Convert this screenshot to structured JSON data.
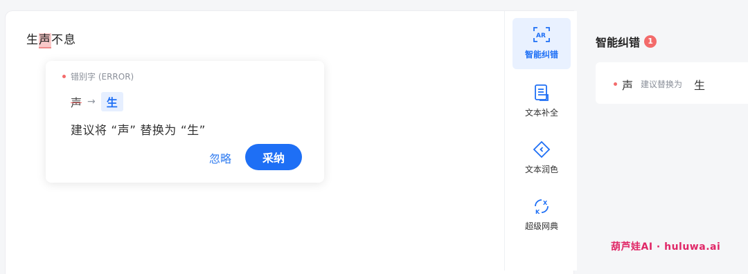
{
  "editor": {
    "before": "生",
    "error_char": "声",
    "after": "不息"
  },
  "popup": {
    "type_label": "错别字 (ERROR)",
    "original": "声",
    "arrow": "→",
    "replacement": "生",
    "description": "建议将 “声” 替换为 “生”",
    "ignore_label": "忽略",
    "adopt_label": "采纳"
  },
  "toolbar": {
    "items": [
      {
        "label": "智能纠错",
        "icon": "ai-correct-icon",
        "active": true
      },
      {
        "label": "文本补全",
        "icon": "document-icon",
        "active": false
      },
      {
        "label": "文本润色",
        "icon": "polish-icon",
        "active": false
      },
      {
        "label": "超级网典",
        "icon": "dictionary-icon",
        "active": false
      }
    ]
  },
  "panel": {
    "title": "智能纠错",
    "badge_count": "1",
    "suggestion": {
      "original": "声",
      "hint": "建议替换为",
      "replacement": "生"
    }
  },
  "watermark": "葫芦娃AI  ·  huluwa.ai",
  "colors": {
    "accent": "#1e6ff5",
    "error": "#f36b6b",
    "watermark": "#e02767"
  }
}
